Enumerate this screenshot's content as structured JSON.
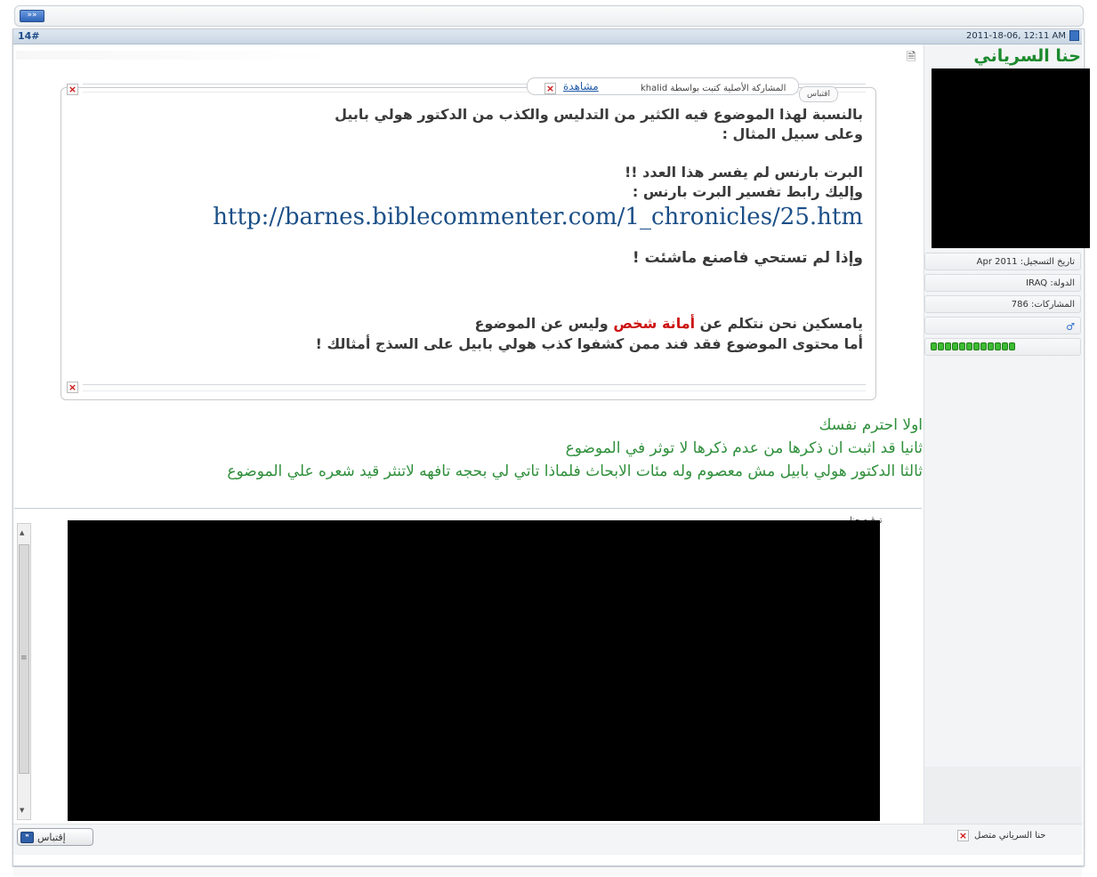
{
  "nav": {
    "arrow": "»»"
  },
  "post": {
    "number": "14#",
    "date": "2011-18-06, 12:11 AM",
    "username": "حنا السرياني",
    "user_info": {
      "join_date": "تاريخ التسجيل: Apr 2011",
      "country": "الدولة: IRAQ",
      "posts": "المشاركات: 786",
      "gender_icon": "male-icon",
      "reputation_pips": 12
    },
    "quote": {
      "tab_label": "اقتباس",
      "author_text": "المشاركة الأصلية كتبت بواسطة khalid",
      "view_label": "مشاهدة",
      "line1": "بالنسبة لهذا الموضوع فيه الكثير من التدليس والكذب من الدكتور هولي بابيل",
      "line2": "وعلى سبيل المثال :",
      "line3": "البرت بارنس لم يفسر هذا العدد !!",
      "line4": "وإليك رابط تفسير البرت بارنس :",
      "url": "http://barnes.biblecommenter.com/1_chronicles/25.htm",
      "line5": "وإذا لم تستحي فاصنع ماشئت !",
      "line6_pre": "يامسكين نحن نتكلم عن ",
      "line6_red": "أمانة شخص",
      "line6_post": " وليس عن الموضوع",
      "line7": "أما محتوى الموضوع فقد فند ممن كشفوا كذب هولي بابيل على السذج أمثالك !"
    },
    "reply": {
      "line1": "اولا احترم نفسك",
      "line2": "ثانيا قد اثبت ان ذكرها من عدم ذكرها لا توثر في الموضوع",
      "line3": "ثالثا الدكتور هولي بابيل مش معصوم وله مئات الابحاث فلماذا تاتي لي بحجه تافهه لاتنثر قيد شعره علي الموضوع"
    },
    "signature_label": "توقيع حنا",
    "quote_button": "إقتباس",
    "status": "حنا السرياني متصل"
  },
  "colors": {
    "username": "#1c8a2e",
    "reply_text": "#2f8f3b",
    "url": "#1b4f87",
    "highlight": "#cc1111",
    "header_bg": "#c9d6e3"
  }
}
